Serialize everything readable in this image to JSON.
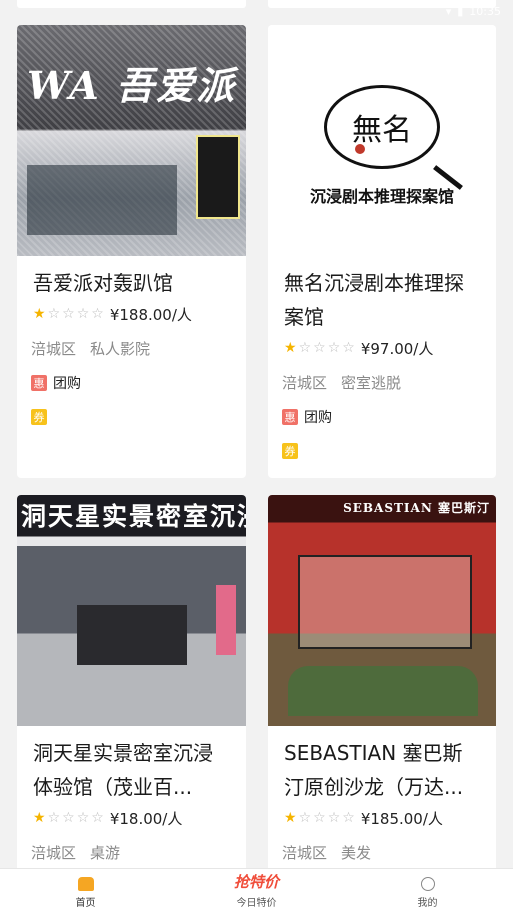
{
  "status_bar": {
    "time": "10:35"
  },
  "cards": [
    {
      "image_sign": "WA 吾爱派",
      "title": "吾爱派对轰趴馆",
      "rating": 1,
      "price": "¥188.00/人",
      "district": "涪城区",
      "category": "私人影院",
      "tag_icon": "惠",
      "tag_text": "团购",
      "coupon_icon": "券"
    },
    {
      "image_sign": "無名",
      "image_subtitle": "沉浸剧本推理探案馆",
      "title": "無名沉浸剧本推理探案馆",
      "rating": 1,
      "price": "¥97.00/人",
      "district": "涪城区",
      "category": "密室逃脱",
      "tag_icon": "惠",
      "tag_text": "团购",
      "coupon_icon": "券"
    },
    {
      "image_sign": "洞天星实景密室沉浸",
      "title": "洞天星实景密室沉浸体验馆（茂业百...",
      "rating": 1,
      "price": "¥18.00/人",
      "district": "涪城区",
      "category": "桌游"
    },
    {
      "image_sign": "SEBASTIAN 塞巴斯汀",
      "title": "SEBASTIAN 塞巴斯汀原创沙龙（万达...",
      "rating": 1,
      "price": "¥185.00/人",
      "district": "涪城区",
      "category": "美发"
    }
  ],
  "bottom_nav": [
    {
      "label": "首页",
      "icon": "home-icon"
    },
    {
      "label": "今日特价",
      "icon": "deal-icon",
      "icon_text": "抢特价"
    },
    {
      "label": "我的",
      "icon": "user-icon"
    }
  ]
}
